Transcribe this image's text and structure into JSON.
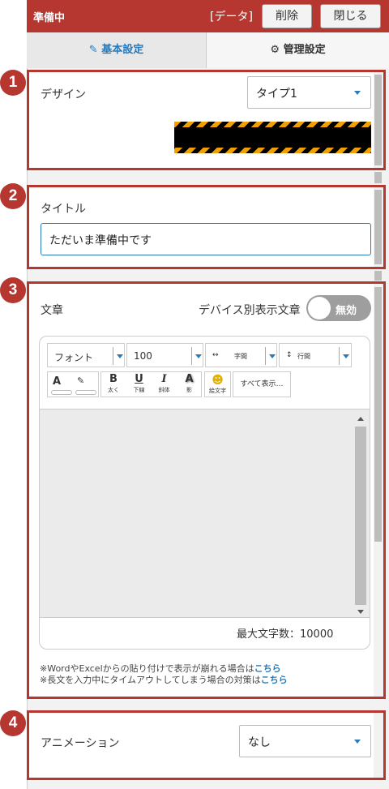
{
  "header": {
    "title": "準備中",
    "tag": "[データ]",
    "delete_label": "削除",
    "close_label": "閉じる"
  },
  "tabs": [
    {
      "icon": "edit-icon",
      "label": "基本設定"
    },
    {
      "icon": "gear-icon",
      "label": "管理設定"
    }
  ],
  "badges": [
    "1",
    "2",
    "3",
    "4"
  ],
  "design": {
    "label": "デザイン",
    "selected": "タイプ1"
  },
  "title_section": {
    "label": "タイトル",
    "value": "ただいま準備中です"
  },
  "body_section": {
    "label": "文章",
    "device_label": "デバイス別表示文章",
    "toggle_label": "無効",
    "toolbar": {
      "font": "フォント",
      "size": "100",
      "letter_spacing": "字間",
      "line_height": "行間",
      "bold": "B",
      "bold_sub": "太く",
      "underline": "U",
      "underline_sub": "下線",
      "italic": "I",
      "italic_sub": "斜体",
      "shadow": "A",
      "shadow_sub": "影",
      "emoji_sub": "絵文字",
      "show_all": "すべて表示…"
    },
    "max_chars": "最大文字数：10000",
    "note1_text": "※WordやExcelからの貼り付けで表示が崩れる場合は",
    "note1_link": "こちら",
    "note2_text": "※長文を入力中にタイムアウトしてしまう場合の対策は",
    "note2_link": "こちら"
  },
  "animation": {
    "label": "アニメーション",
    "selected": "なし"
  },
  "colors": {
    "header": "#b5372f",
    "accent": "#2a7ab8",
    "annotation": "#b5372f"
  }
}
